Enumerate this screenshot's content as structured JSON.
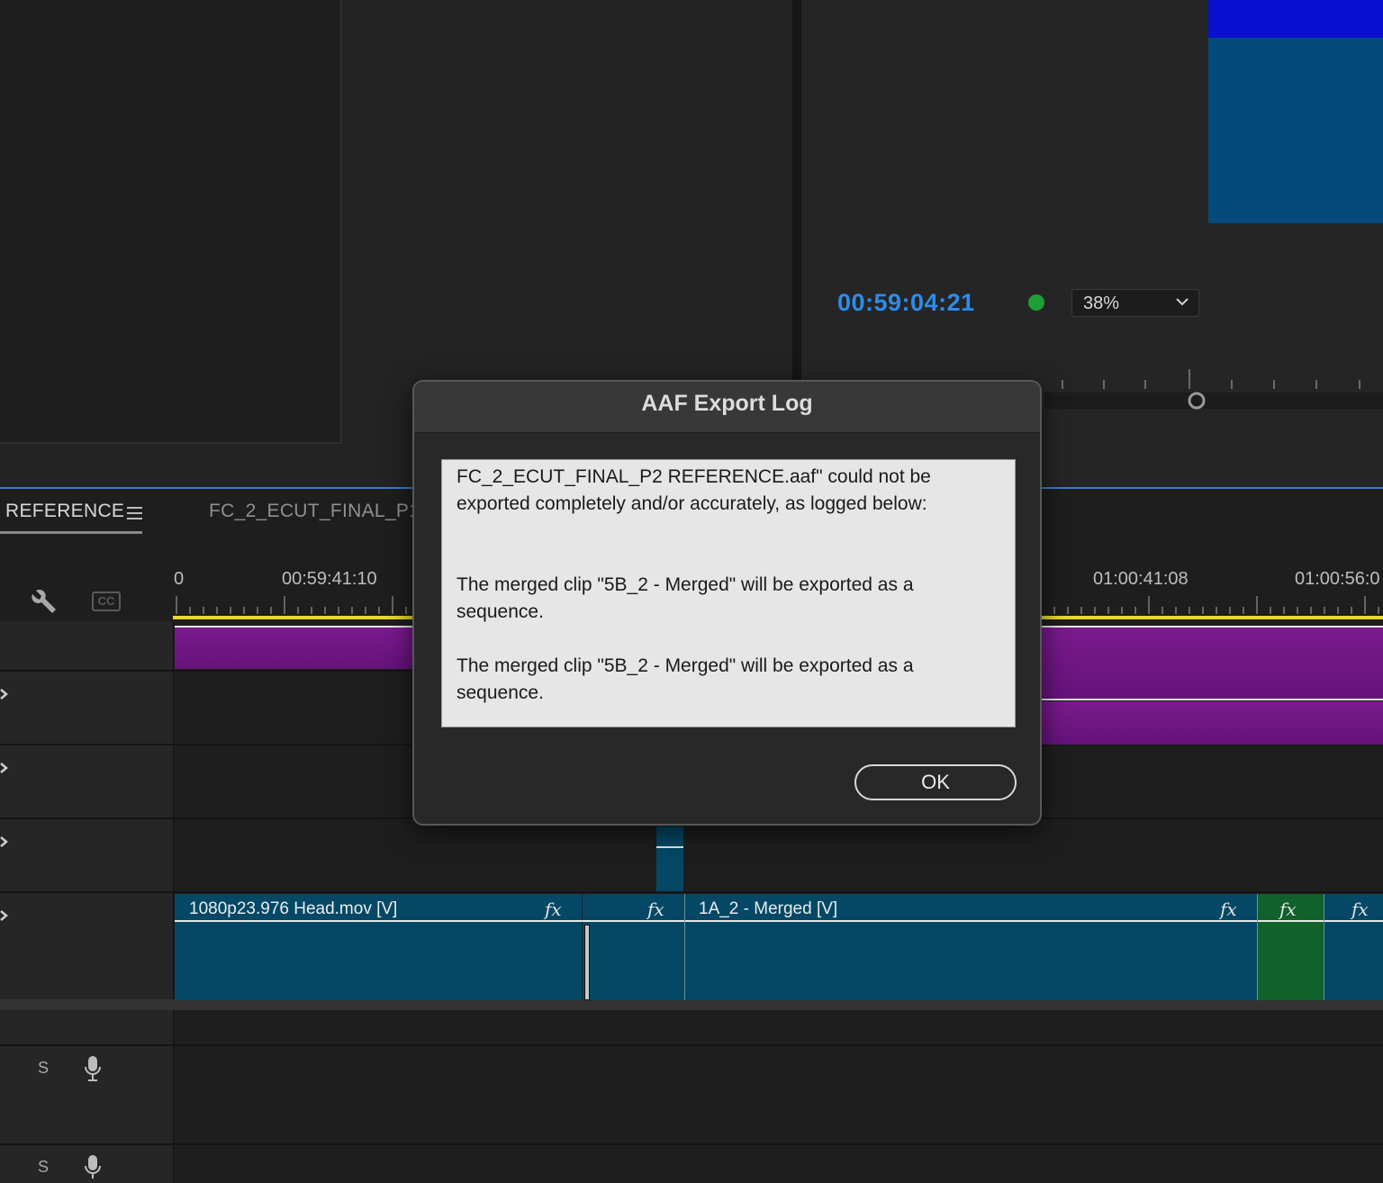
{
  "program_monitor": {
    "timecode": "00:59:04:21",
    "zoom": "38%",
    "status_color": "#1f9e35"
  },
  "timeline": {
    "active_tab": "REFERENCE",
    "other_tab": "FC_2_ECUT_FINAL_P1",
    "ruler_ticks": [
      "0",
      "00:59:41:10",
      "01:00:41:08",
      "01:00:56:0"
    ],
    "cc_label": "CC",
    "video_clips": [
      {
        "label": "1080p23.976 Head.mov [V]",
        "fx": "fx"
      },
      {
        "label": "",
        "fx": "fx"
      },
      {
        "label": "1A_2 - Merged [V]",
        "fx": "fx"
      },
      {
        "label": "",
        "fx": "fx"
      },
      {
        "label": "",
        "fx": "fx"
      }
    ],
    "audio_tracks": [
      {
        "solo": "S",
        "mic": "microphone-icon"
      },
      {
        "solo": "S",
        "mic": "microphone-icon"
      }
    ]
  },
  "dialog": {
    "title": "AAF Export Log",
    "log_lines": [
      "FC_2_ECUT_FINAL_P2 REFERENCE.aaf\" could not be",
      "exported completely and/or accurately, as logged below:",
      "",
      "",
      "The merged clip \"5B_2 - Merged\" will be exported as a",
      "sequence.",
      "",
      "The merged clip \"5B_2 - Merged\" will be exported as a",
      "sequence."
    ],
    "ok_label": "OK"
  },
  "colors": {
    "timecode": "#2d8ceb",
    "video_clip": "#044866",
    "audio_clip": "#7a1a8e",
    "adjust_clip": "#11612a",
    "play_range": "#e6d92e"
  }
}
